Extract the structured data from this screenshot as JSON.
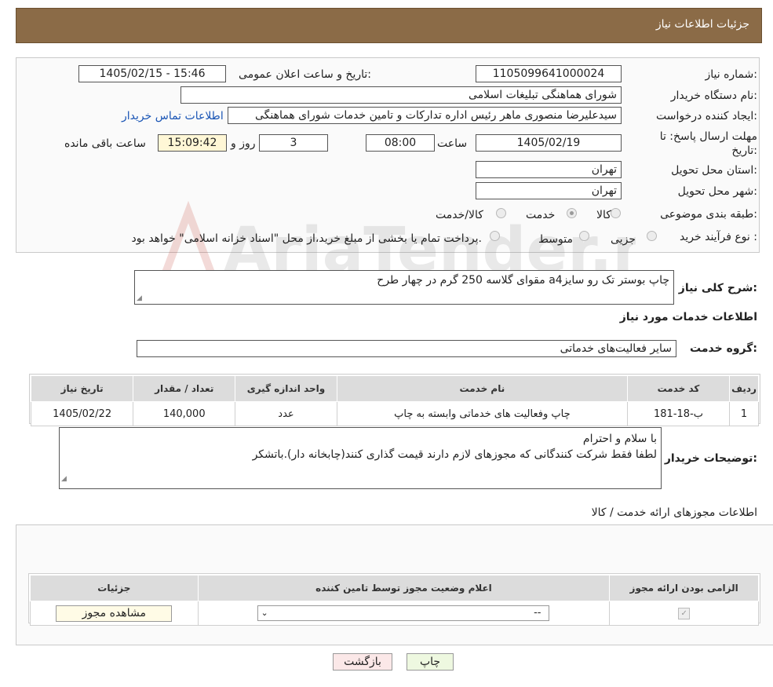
{
  "header": {
    "title": "جزئیات اطلاعات نیاز"
  },
  "fields": {
    "need_number_label": "شماره نیاز:",
    "need_number": "1105099641000024",
    "announce_label": "تاریخ و ساعت اعلان عمومی:",
    "announce_value": "1405/02/15 - 15:46",
    "buyer_org_label": "نام دستگاه خریدار:",
    "buyer_org": "شورای هماهنگی تبلیغات اسلامی",
    "creator_label": "ایجاد کننده درخواست:",
    "creator": "سیدعلیرضا منصوری ماهر رئیس اداره تدارکات و تامین خدمات  شورای هماهنگی",
    "contact_link": "اطلاعات تماس خریدار",
    "deadline_label_1": "مهلت ارسال پاسخ: تا",
    "deadline_label_2": "تاریخ:",
    "deadline_date": "1405/02/19",
    "time_label": "ساعت",
    "deadline_time": "08:00",
    "days": "3",
    "days_label": "روز و",
    "remaining_time": "15:09:42",
    "remaining_label": "ساعت باقی مانده",
    "province_label": "استان محل تحویل:",
    "province": "تهران",
    "city_label": "شهر محل تحویل:",
    "city": "تهران",
    "category_label": "طبقه بندی موضوعی:",
    "category_options": [
      "کالا",
      "خدمت",
      "کالا/خدمت"
    ],
    "category_selected": "خدمت",
    "process_label": "نوع فرآیند خرید :",
    "process_options": [
      "جزیی",
      "متوسط"
    ],
    "process_note": "پرداخت تمام یا بخشی از مبلغ خرید،از محل \"اسناد خزانه اسلامی\" خواهد بود."
  },
  "summary": {
    "label": "شرح کلی نیاز:",
    "value": "چاپ بوستر تک رو سایزa4 مقوای گلاسه 250 گرم در چهار طرح"
  },
  "services": {
    "section_title": "اطلاعات خدمات مورد نیاز",
    "group_label": "گروه خدمت:",
    "group_value": "سایر فعالیت‌های خدماتی",
    "columns": [
      "ردیف",
      "کد خدمت",
      "نام خدمت",
      "واحد اندازه گیری",
      "تعداد / مقدار",
      "تاریخ نیاز"
    ],
    "rows": [
      [
        "1",
        "ب-18-181",
        "چاپ وفعالیت های خدماتی وابسته به چاپ",
        "عدد",
        "140,000",
        "1405/02/22"
      ]
    ]
  },
  "buyer_notes": {
    "label": "توضیحات خریدار:",
    "line1": "با سلام و احترام",
    "line2": "لطفا فقط شرکت کنندگانی که مجوزهای لازم دارند قیمت گذاری کنند(چابخانه دار).باتشکر"
  },
  "licenses": {
    "section_title": "اطلاعات مجوزهای ارائه خدمت / کالا",
    "columns": [
      "الزامی بودن ارائه مجوز",
      "اعلام وضعیت مجوز توسط تامین کننده",
      "جزئیات"
    ],
    "select_value": "--",
    "view_button": "مشاهده مجوز"
  },
  "footer": {
    "print_button": "چاپ",
    "back_button": "بازگشت"
  },
  "watermark": {
    "text": "AriaTender.neT"
  }
}
